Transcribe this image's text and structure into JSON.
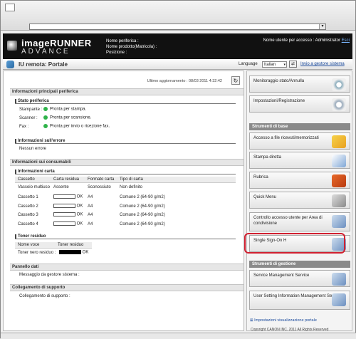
{
  "header": {
    "logo_line1": "imageRUNNER",
    "logo_line2": "ADVANCE",
    "device_name_label": "Nome periferica :",
    "product_name_label": "Nome prodotto(Matricola) :",
    "location_label": "Posizione :",
    "user_label": "Nome utente per accesso : Administrator",
    "logout_link": "Esci"
  },
  "subheader": {
    "title": "IU remota: Portale",
    "language_label": "Language",
    "language_value": "Italian",
    "go_admin_link": "Invio a gestore sistema"
  },
  "main": {
    "last_update": "Ultimo aggiornamento : 08/03 2011 4:32:42",
    "device_info": {
      "title": "Informazioni principali periferica",
      "status_title": "Stato periferica",
      "statuses": [
        {
          "label": "Stampante :",
          "value": "Pronta per stampa."
        },
        {
          "label": "Scanner :",
          "value": "Pronta per scansione."
        },
        {
          "label": "Fax :",
          "value": "Pronta per invio o ricezione fax."
        }
      ],
      "error_title": "Informazioni sull'errore",
      "error_value": "Nessun errore"
    },
    "consumables": {
      "title": "Informazioni sui consumabili",
      "paper_title": "Informazioni carta",
      "columns": [
        "Cassetto",
        "Carta residua",
        "Formato carta",
        "Tipo di carta"
      ],
      "rows": [
        {
          "name": "Vassoio multiuso",
          "remaining": "Assente",
          "ok": "",
          "size": "Sconosciuto",
          "type": "Non definito"
        },
        {
          "name": "Cassetto 1",
          "remaining": "",
          "ok": "OK",
          "size": "A4",
          "type": "Comune 2 (64-90 g/m2)"
        },
        {
          "name": "Cassetto 2",
          "remaining": "",
          "ok": "OK",
          "size": "A4",
          "type": "Comune 2 (64-90 g/m2)"
        },
        {
          "name": "Cassetto 3",
          "remaining": "",
          "ok": "OK",
          "size": "A4",
          "type": "Comune 2 (64-90 g/m2)"
        },
        {
          "name": "Cassetto 4",
          "remaining": "",
          "ok": "OK",
          "size": "A4",
          "type": "Comune 2 (64-90 g/m2)"
        }
      ],
      "toner_title": "Toner residuo",
      "toner_columns": [
        "Nome voce",
        "Toner residuo"
      ],
      "toner_row": {
        "name": "Toner nero residuo :",
        "ok": "OK"
      }
    },
    "panel": {
      "title": "Pannello dati",
      "message": "Messaggio da gestore sistema :"
    },
    "support": {
      "title": "Collegamento di supporto",
      "link": "Collegamento di supporto :"
    }
  },
  "sidebar": {
    "monitoring": "Monitoraggio stato/Annulla",
    "settings": "Impostazioni/Registrazione",
    "basic_tools_title": "Strumenti di base",
    "basic": [
      "Accesso a file ricevuti/memorizzati",
      "Stampa diretta",
      "Rubrica",
      "Quick Menu",
      "Controllo accesso utente per Area di condivisione",
      "Single Sign-On H"
    ],
    "mgmt_title": "Strumenti di gestione",
    "mgmt": [
      "Service Management Service",
      "User Setting Information Management Service"
    ],
    "portal_settings": "Impostazioni visualizzazione portale",
    "copyright": "Copyright CANON INC. 2011 All Rights Reserved"
  }
}
